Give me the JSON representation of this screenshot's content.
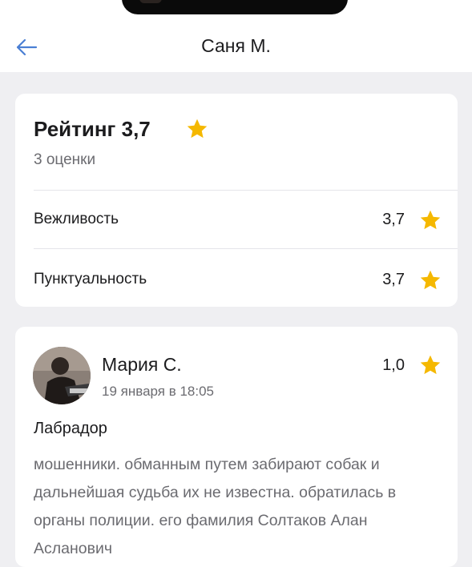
{
  "header": {
    "title": "Саня М.",
    "back_icon": "arrow-left-icon",
    "accent_color": "#4a7fd4"
  },
  "rating": {
    "title": "Рейтинг 3,7",
    "count": "3 оценки",
    "star_color": "#f5b800",
    "rows": [
      {
        "label": "Вежливость",
        "value": "3,7"
      },
      {
        "label": "Пунктуальность",
        "value": "3,7"
      }
    ]
  },
  "review": {
    "author": "Мария С.",
    "date": "19 января в 18:05",
    "score": "1,0",
    "subject": "Лабрадор",
    "text": "мошенники. обманным путем забирают собак и дальнейшая судьба их не известна. обратилась в органы полиции. его фамилия Солтаков Алан Асланович"
  }
}
